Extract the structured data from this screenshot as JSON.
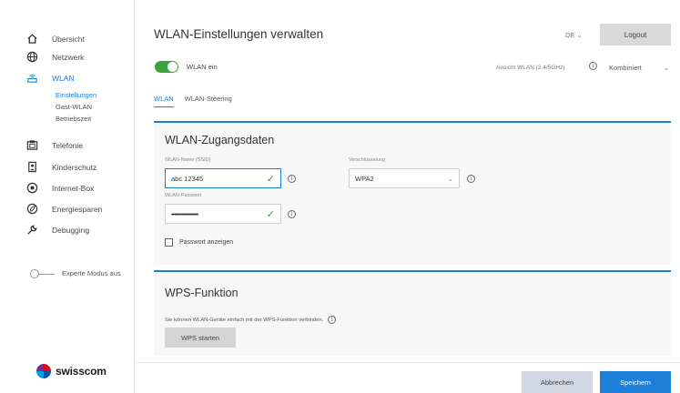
{
  "sidebar": {
    "items": [
      {
        "label": "Übersicht",
        "icon": "home-icon"
      },
      {
        "label": "Netzwerk",
        "icon": "globe-icon"
      },
      {
        "label": "WLAN",
        "icon": "wifi-router-icon"
      },
      {
        "label": "Telefonie",
        "icon": "phone-icon"
      },
      {
        "label": "Kinderschutz",
        "icon": "child-protection-icon"
      },
      {
        "label": "Internet-Box",
        "icon": "box-icon"
      },
      {
        "label": "Energiesparen",
        "icon": "energy-icon"
      },
      {
        "label": "Debugging",
        "icon": "wrench-icon"
      }
    ],
    "sub_items": [
      "Einstellungen",
      "Gast-WLAN",
      "Betriebszeit"
    ],
    "expert_mode_label": "Experte Modus aus",
    "logo_text": "swisscom"
  },
  "header": {
    "title": "WLAN-Einstellungen verwalten",
    "language": "DE",
    "logout_label": "Logout"
  },
  "wlan_toggle": {
    "label": "WLAN ein",
    "on": true
  },
  "view": {
    "label": "Ansicht WLAN (2.4/5GHz)",
    "selected": "Kombiniert"
  },
  "tabs": [
    "WLAN",
    "WLAN-Steering"
  ],
  "credentials": {
    "title": "WLAN-Zugangsdaten",
    "ssid_label": "WLAN-Name (SSID)",
    "ssid_value": "abc 12345",
    "password_label": "WLAN-Passwort",
    "password_value": "••••••••••••••••••",
    "encryption_label": "Verschlüsselung",
    "encryption_value": "WPA2",
    "show_password_label": "Passwort anzeigen"
  },
  "wps": {
    "title": "WPS-Funktion",
    "description": "Sie können WLAN-Geräte einfach mit der WPS-Funktion verbinden.",
    "button_label": "WPS starten"
  },
  "footer": {
    "cancel_label": "Abbrechen",
    "save_label": "Speichern"
  },
  "colors": {
    "accent": "#1e7fd6",
    "toggle_on": "#3ca23c"
  }
}
